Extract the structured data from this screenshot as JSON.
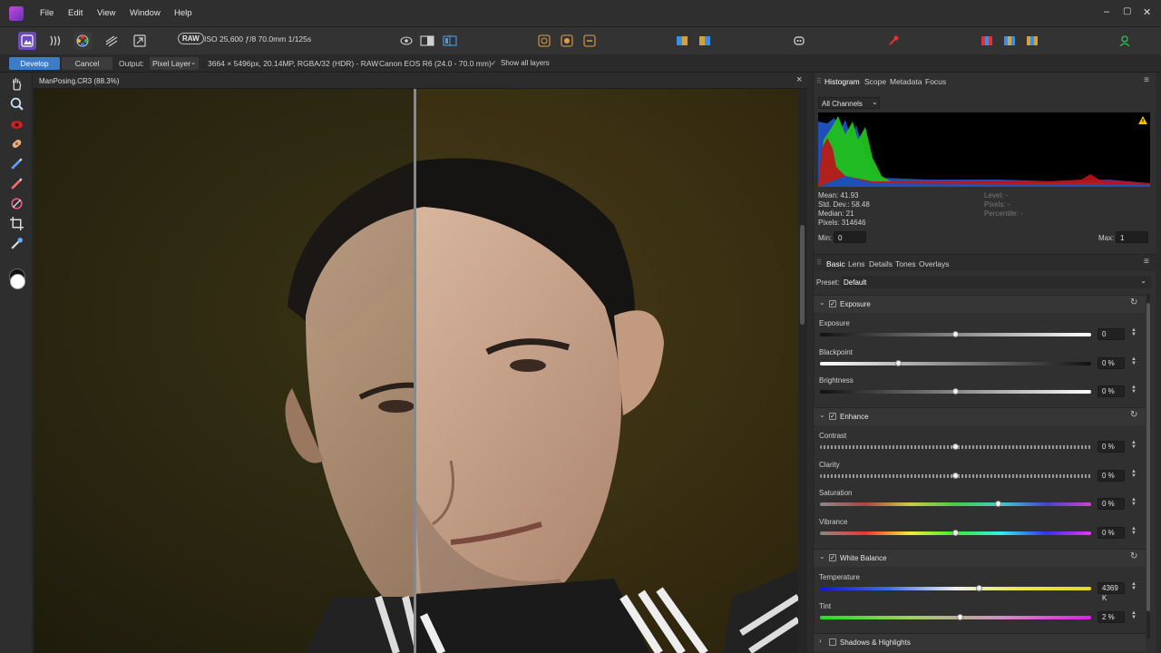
{
  "menu": {
    "items": [
      "File",
      "Edit",
      "View",
      "Window",
      "Help"
    ]
  },
  "toolbar": {
    "raw_badge": "RAW",
    "exif": "ISO 25,600 ƒ/8 70.0mm 1/125s"
  },
  "context": {
    "develop": "Develop",
    "cancel": "Cancel",
    "output_label": "Output:",
    "output_value": "Pixel Layer",
    "image_info": "3664 × 5496px, 20.14MP, RGBA/32 (HDR) - RAW",
    "camera_info": "Canon EOS R6 (24.0 - 70.0 mm)",
    "show_all_layers": "Show all layers"
  },
  "document": {
    "title": "ManPosing.CR3 (88.3%)",
    "close": "×"
  },
  "histogram_panel": {
    "tabs": [
      "Histogram",
      "Scope",
      "Metadata",
      "Focus"
    ],
    "channel": "All Channels",
    "stats": {
      "mean": "Mean: 41.93",
      "std_dev": "Std. Dev.: 58.48",
      "median": "Median: 21",
      "pixels": "Pixels: 314646",
      "level": "Level: -",
      "pixels_r": "Pixels: -",
      "percentile": "Percentile: -"
    },
    "min_label": "Min:",
    "min_value": "0",
    "max_label": "Max:",
    "max_value": "1",
    "warning_color": "#f2c200"
  },
  "develop_panel": {
    "tabs": [
      "Basic",
      "Lens",
      "Details",
      "Tones",
      "Overlays"
    ],
    "preset_label": "Preset:",
    "preset_value": "Default",
    "sections": {
      "exposure": {
        "title": "Exposure",
        "sliders": [
          {
            "label": "Exposure",
            "value": "0",
            "pos": 0.5
          },
          {
            "label": "Blackpoint",
            "value": "0 %",
            "pos": 0.29
          },
          {
            "label": "Brightness",
            "value": "0 %",
            "pos": 0.5
          }
        ]
      },
      "enhance": {
        "title": "Enhance",
        "sliders": [
          {
            "label": "Contrast",
            "value": "0 %",
            "pos": 0.5
          },
          {
            "label": "Clarity",
            "value": "0 %",
            "pos": 0.5
          },
          {
            "label": "Saturation",
            "value": "0 %",
            "pos": 0.66
          },
          {
            "label": "Vibrance",
            "value": "0 %",
            "pos": 0.5
          }
        ]
      },
      "white_balance": {
        "title": "White Balance",
        "sliders": [
          {
            "label": "Temperature",
            "value": "4369 K",
            "pos": 0.59
          },
          {
            "label": "Tint",
            "value": "2 %",
            "pos": 0.52
          }
        ]
      },
      "shadows": {
        "title": "Shadows & Highlights"
      }
    }
  },
  "colors": {
    "accent": "#3d7cc9",
    "histogram_blue": "#1f4fb8",
    "histogram_green": "#22c21c",
    "histogram_red": "#c0101c"
  }
}
